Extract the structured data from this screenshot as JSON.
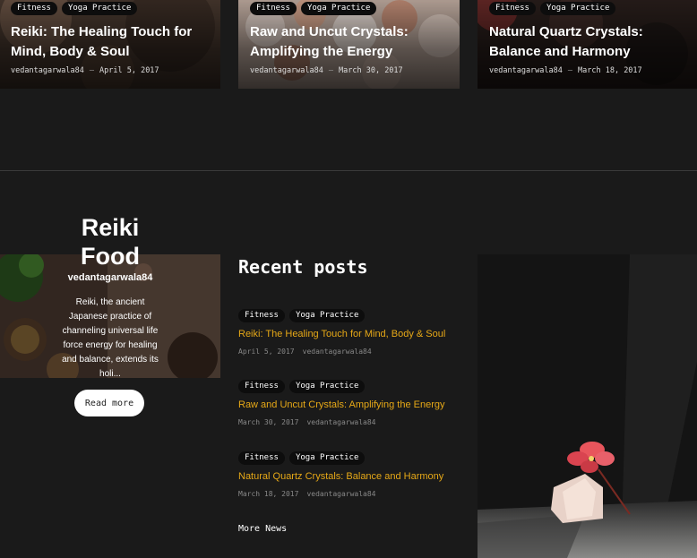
{
  "top_cards": [
    {
      "tags": [
        "Fitness",
        "Yoga Practice"
      ],
      "title_line1": "Reiki: The Healing Touch for",
      "title_line2": "Mind, Body & Soul",
      "author": "vedantagarwala84",
      "date": "April 5, 2017"
    },
    {
      "tags": [
        "Fitness",
        "Yoga Practice"
      ],
      "title_line1": "Raw and Uncut Crystals:",
      "title_line2": "Amplifying the Energy",
      "author": "vedantagarwala84",
      "date": "March 30, 2017"
    },
    {
      "tags": [
        "Fitness",
        "Yoga Practice"
      ],
      "title_line1": "Natural Quartz Crystals:",
      "title_line2": "Balance and Harmony",
      "author": "vedantagarwala84",
      "date": "March 18, 2017"
    }
  ],
  "feature": {
    "title_line1": "Reiki",
    "title_line2": "Food",
    "author": "vedantagarwala84",
    "excerpt": "Reiki, the ancient Japanese practice of channeling universal life force energy for healing and balance, extends its holi...",
    "read_more": "Read more"
  },
  "recent": {
    "heading": "Recent posts",
    "posts": [
      {
        "tags": [
          "Fitness",
          "Yoga Practice"
        ],
        "title": "Reiki: The Healing Touch for Mind, Body & Soul",
        "date": "April 5, 2017",
        "author": "vedantagarwala84"
      },
      {
        "tags": [
          "Fitness",
          "Yoga Practice"
        ],
        "title": "Raw and Uncut Crystals: Amplifying the Energy",
        "date": "March 30, 2017",
        "author": "vedantagarwala84"
      },
      {
        "tags": [
          "Fitness",
          "Yoga Practice"
        ],
        "title": "Natural Quartz Crystals: Balance and Harmony",
        "date": "March 18, 2017",
        "author": "vedantagarwala84"
      }
    ],
    "more_news": "More News"
  },
  "colors": {
    "background": "#1a1a1a",
    "accent": "#e6a817",
    "tag_bg": "#0d0d0d"
  }
}
